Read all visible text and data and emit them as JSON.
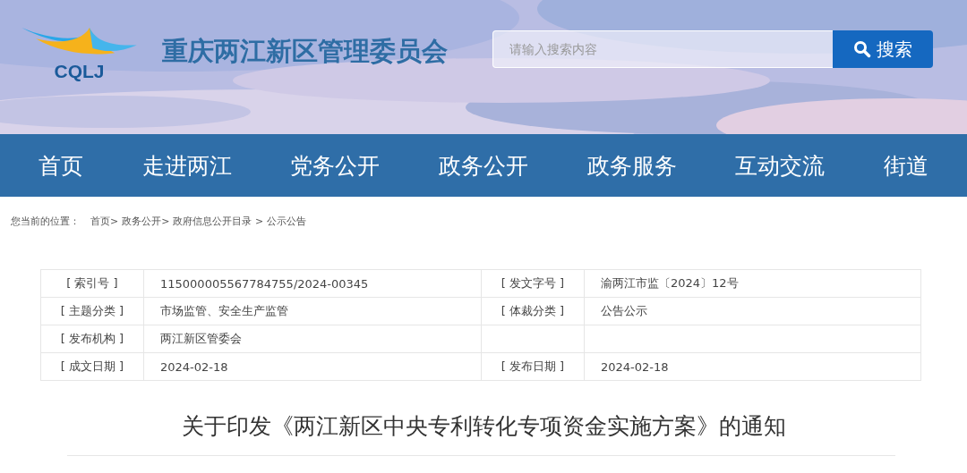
{
  "header": {
    "logo_text": "CQLJ",
    "site_title": "重庆两江新区管理委员会",
    "search": {
      "placeholder": "请输入搜索内容",
      "button": "搜索"
    }
  },
  "nav": [
    "首页",
    "走进两江",
    "党务公开",
    "政务公开",
    "政务服务",
    "互动交流",
    "街道"
  ],
  "breadcrumb": {
    "label": "您当前的位置：",
    "items": [
      "首页>",
      "政务公开>",
      "政府信息公开目录 >",
      "公示公告"
    ]
  },
  "info_table": [
    [
      {
        "label": "[ 索引号 ]",
        "value": "115000005567784755/2024-00345"
      },
      {
        "label": "[ 发文字号 ]",
        "value": "渝两江市监〔2024〕12号"
      }
    ],
    [
      {
        "label": "[ 主题分类 ]",
        "value": "市场监管、安全生产监管"
      },
      {
        "label": "[ 体裁分类 ]",
        "value": "公告公示"
      }
    ],
    [
      {
        "label": "[ 发布机构 ]",
        "value": "两江新区管委会"
      }
    ],
    [
      {
        "label": "[ 成文日期 ]",
        "value": "2024-02-18"
      },
      {
        "label": "[ 发布日期 ]",
        "value": "2024-02-18"
      }
    ]
  ],
  "article_title": "关于印发《两江新区中央专利转化专项资金实施方案》的通知"
}
